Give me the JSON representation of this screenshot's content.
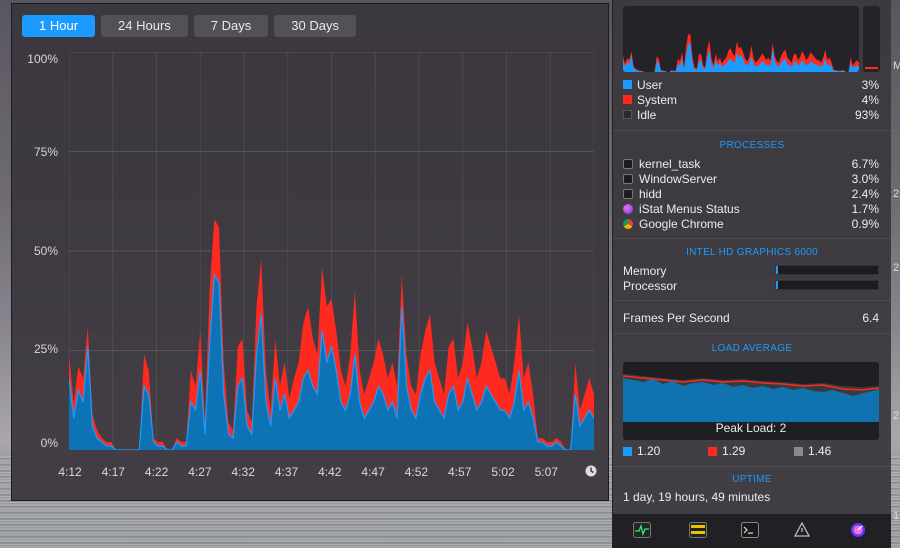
{
  "graph": {
    "tabs": [
      {
        "label": "1 Hour",
        "active": true
      },
      {
        "label": "24 Hours",
        "active": false
      },
      {
        "label": "7 Days",
        "active": false
      },
      {
        "label": "30 Days",
        "active": false
      }
    ],
    "y_labels": [
      "100%",
      "75%",
      "50%",
      "25%",
      "0%"
    ],
    "x_labels": [
      "4:12",
      "4:17",
      "4:22",
      "4:27",
      "4:32",
      "4:37",
      "4:42",
      "4:47",
      "4:52",
      "4:57",
      "5:02",
      "5:07"
    ]
  },
  "cpu_breakdown": {
    "items": [
      {
        "label": "User",
        "value": "3%",
        "color": "#1b9bff"
      },
      {
        "label": "System",
        "value": "4%",
        "color": "#ff2a1f"
      },
      {
        "label": "Idle",
        "value": "93%",
        "color": "#2b2a2e"
      }
    ]
  },
  "processes": {
    "title": "PROCESSES",
    "items": [
      {
        "name": "kernel_task",
        "value": "6.7%",
        "icon": "terminal-icon"
      },
      {
        "name": "WindowServer",
        "value": "3.0%",
        "icon": "terminal-icon"
      },
      {
        "name": "hidd",
        "value": "2.4%",
        "icon": "terminal-icon"
      },
      {
        "name": "iStat Menus Status",
        "value": "1.7%",
        "icon": "istat-icon"
      },
      {
        "name": "Google Chrome",
        "value": "0.9%",
        "icon": "chrome-icon"
      }
    ]
  },
  "gpu": {
    "title": "INTEL HD GRAPHICS 6000",
    "memory_label": "Memory",
    "memory_fraction": 0.02,
    "processor_label": "Processor",
    "processor_fraction": 0.02,
    "fps_label": "Frames Per Second",
    "fps_value": "6.4"
  },
  "load": {
    "title": "LOAD AVERAGE",
    "peak": "Peak Load: 2",
    "values": [
      {
        "value": "1.20",
        "color": "#1b9bff"
      },
      {
        "value": "1.29",
        "color": "#ff2a1f"
      },
      {
        "value": "1.46",
        "color": "#8a8a8a"
      }
    ]
  },
  "uptime": {
    "title": "UPTIME",
    "value": "1 day, 19 hours, 49 minutes"
  },
  "footer_icons": [
    "activity-monitor-icon",
    "console-icon",
    "terminal-icon",
    "resource-icon",
    "istat-icon"
  ],
  "edge_letters": [
    "M",
    "2",
    "2",
    "2",
    "1"
  ],
  "chart_data": {
    "type": "area",
    "ylim": [
      0,
      100
    ],
    "y_ticks": [
      0,
      25,
      50,
      75,
      100
    ],
    "series": [
      {
        "name": "User",
        "color": "#1b9bff",
        "values": [
          18,
          8,
          15,
          12,
          26,
          6,
          3,
          2,
          1,
          1,
          0,
          0,
          0,
          0,
          0,
          0,
          16,
          14,
          2,
          1,
          1,
          0,
          0,
          2,
          1,
          1,
          12,
          10,
          20,
          4,
          26,
          44,
          42,
          14,
          4,
          3,
          16,
          18,
          6,
          4,
          24,
          34,
          12,
          6,
          18,
          10,
          14,
          8,
          10,
          12,
          18,
          20,
          16,
          14,
          30,
          22,
          26,
          20,
          12,
          10,
          14,
          24,
          12,
          8,
          10,
          12,
          16,
          14,
          10,
          12,
          8,
          36,
          16,
          10,
          8,
          14,
          18,
          20,
          12,
          10,
          8,
          14,
          16,
          10,
          12,
          18,
          14,
          10,
          12,
          16,
          14,
          12,
          10,
          10,
          8,
          12,
          20,
          10,
          12,
          8,
          2,
          2,
          1,
          1,
          2,
          1,
          0,
          0,
          14,
          6,
          8,
          10,
          8
        ]
      },
      {
        "name": "System",
        "color": "#ff2a1f",
        "values": [
          6,
          4,
          6,
          6,
          5,
          3,
          2,
          1,
          1,
          1,
          0,
          0,
          0,
          0,
          0,
          0,
          8,
          6,
          1,
          1,
          1,
          0,
          0,
          1,
          1,
          1,
          8,
          6,
          10,
          3,
          14,
          14,
          14,
          8,
          3,
          2,
          10,
          10,
          4,
          3,
          12,
          14,
          8,
          4,
          10,
          6,
          8,
          5,
          8,
          10,
          14,
          16,
          12,
          10,
          16,
          14,
          12,
          10,
          8,
          6,
          10,
          16,
          8,
          6,
          8,
          10,
          12,
          10,
          8,
          10,
          8,
          8,
          8,
          6,
          6,
          10,
          12,
          14,
          10,
          8,
          6,
          12,
          12,
          8,
          10,
          14,
          12,
          8,
          10,
          14,
          12,
          10,
          8,
          8,
          6,
          10,
          14,
          8,
          10,
          6,
          1,
          1,
          1,
          1,
          1,
          1,
          0,
          0,
          8,
          4,
          6,
          8,
          6
        ]
      }
    ]
  }
}
